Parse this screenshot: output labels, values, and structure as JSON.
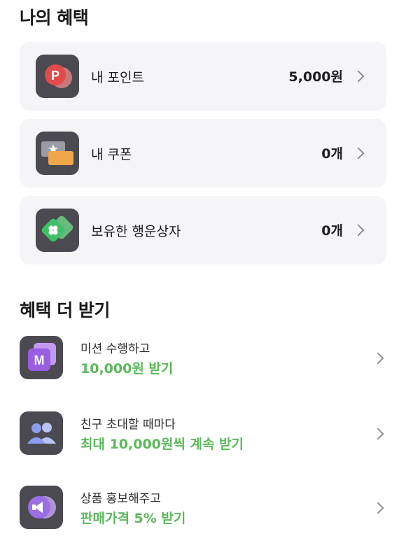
{
  "my_benefits": {
    "title": "나의 혜택",
    "items": [
      {
        "label": "내 포인트",
        "value": "5,000원",
        "icon": "point-icon"
      },
      {
        "label": "내 쿠폰",
        "value": "0개",
        "icon": "coupon-icon"
      },
      {
        "label": "보유한 행운상자",
        "value": "0개",
        "icon": "lucky-box-icon"
      }
    ]
  },
  "more_benefits": {
    "title": "혜택 더 받기",
    "items": [
      {
        "line1": "미션 수행하고",
        "line2": "10,000원 받기",
        "icon": "mission-icon",
        "icon_text": "M"
      },
      {
        "line1": "친구 초대할 때마다",
        "line2": "최대 10,000원씩 계속 받기",
        "icon": "invite-friends-icon"
      },
      {
        "line1": "상품 홍보해주고",
        "line2": "판매가격 5% 받기",
        "icon": "promote-megaphone-icon"
      }
    ]
  },
  "colors": {
    "accent_green": "#5cb85c",
    "card_bg": "#f5f5f7",
    "icon_bg": "#4a4a50"
  }
}
